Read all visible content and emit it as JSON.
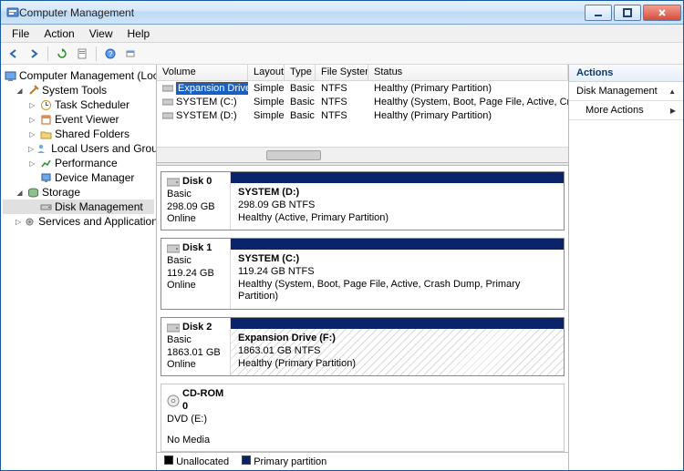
{
  "window": {
    "title": "Computer Management"
  },
  "menu": {
    "file": "File",
    "action": "Action",
    "view": "View",
    "help": "Help"
  },
  "tree": {
    "root": "Computer Management (Local)",
    "system_tools": "System Tools",
    "task_scheduler": "Task Scheduler",
    "event_viewer": "Event Viewer",
    "shared_folders": "Shared Folders",
    "local_users": "Local Users and Groups",
    "performance": "Performance",
    "device_manager": "Device Manager",
    "storage": "Storage",
    "disk_management": "Disk Management",
    "services_apps": "Services and Applications"
  },
  "vol_cols": {
    "volume": "Volume",
    "layout": "Layout",
    "type": "Type",
    "fs": "File System",
    "status": "Status"
  },
  "volumes": [
    {
      "name": "Expansion Drive (F:)",
      "layout": "Simple",
      "type": "Basic",
      "fs": "NTFS",
      "status": "Healthy (Primary Partition)",
      "selected": true
    },
    {
      "name": "SYSTEM (C:)",
      "layout": "Simple",
      "type": "Basic",
      "fs": "NTFS",
      "status": "Healthy (System, Boot, Page File, Active, Crash Dump, Primary Partition)",
      "selected": false
    },
    {
      "name": "SYSTEM (D:)",
      "layout": "Simple",
      "type": "Basic",
      "fs": "NTFS",
      "status": "Healthy (Primary Partition)",
      "selected": false
    }
  ],
  "disks": [
    {
      "name": "Disk 0",
      "kind": "Basic",
      "size": "298.09 GB",
      "state": "Online",
      "vol_name": "SYSTEM  (D:)",
      "vol_size": "298.09 GB NTFS",
      "vol_status": "Healthy (Active, Primary Partition)",
      "hatched": false,
      "media": "disk"
    },
    {
      "name": "Disk 1",
      "kind": "Basic",
      "size": "119.24 GB",
      "state": "Online",
      "vol_name": "SYSTEM  (C:)",
      "vol_size": "119.24 GB NTFS",
      "vol_status": "Healthy (System, Boot, Page File, Active, Crash Dump, Primary Partition)",
      "hatched": false,
      "media": "disk"
    },
    {
      "name": "Disk 2",
      "kind": "Basic",
      "size": "1863.01 GB",
      "state": "Online",
      "vol_name": "Expansion Drive  (F:)",
      "vol_size": "1863.01 GB NTFS",
      "vol_status": "Healthy (Primary Partition)",
      "hatched": true,
      "media": "disk"
    },
    {
      "name": "CD-ROM 0",
      "kind": "DVD (E:)",
      "size": "",
      "state": "No Media",
      "vol_name": "",
      "vol_size": "",
      "vol_status": "",
      "hatched": false,
      "media": "cd",
      "empty": true
    }
  ],
  "legend": {
    "unalloc": "Unallocated",
    "primary": "Primary partition"
  },
  "actions": {
    "header": "Actions",
    "group": "Disk Management",
    "more": "More Actions"
  }
}
